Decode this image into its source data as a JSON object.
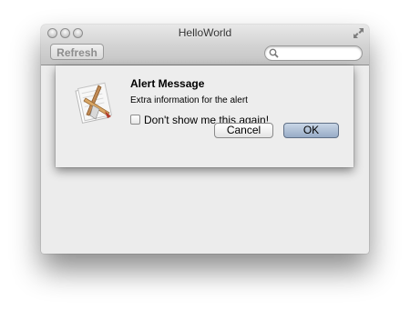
{
  "window": {
    "title": "HelloWorld"
  },
  "toolbar": {
    "refresh_label": "Refresh",
    "search_placeholder": ""
  },
  "alert": {
    "title": "Alert Message",
    "info": "Extra information for the alert",
    "checkbox_label": "Don't show me this again!",
    "checkbox_checked": false,
    "cancel_label": "Cancel",
    "ok_label": "OK",
    "icon": "app-icon"
  },
  "icons": {
    "close": "close-icon",
    "minimize": "minimize-icon",
    "zoom": "zoom-icon",
    "fullscreen": "fullscreen-icon",
    "search": "search-icon"
  },
  "colors": {
    "default_button": "#97abc6",
    "window_background": "#ececec"
  }
}
